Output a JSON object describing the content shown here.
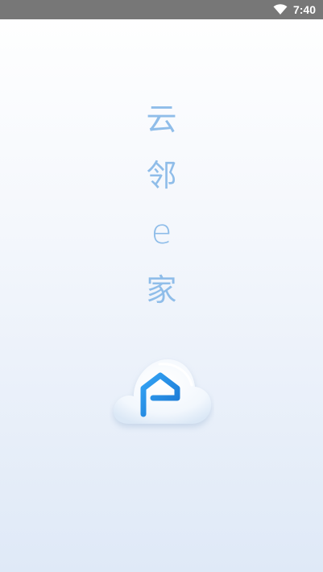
{
  "status_bar": {
    "time": "7:40",
    "wifi_icon": "wifi-icon"
  },
  "splash": {
    "title_chars": [
      "云",
      "邻",
      "e",
      "家"
    ],
    "logo_icon": "cloud-house-logo",
    "accent_color": "#1e88e5",
    "text_color": "#8fbde9"
  }
}
